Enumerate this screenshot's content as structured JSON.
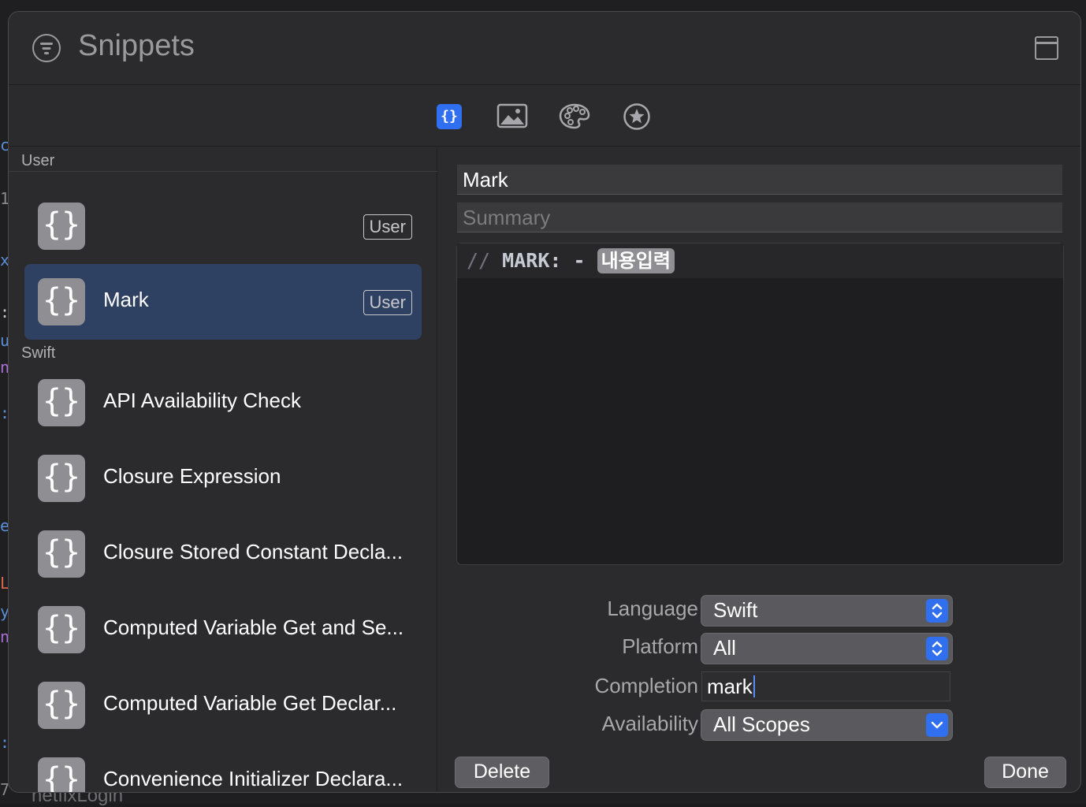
{
  "background": {
    "bottom_text": "netfixLogin"
  },
  "window": {
    "title": "Snippets",
    "filter_icon": "filter-icon",
    "layout_icon": "layout-icon"
  },
  "tabs": [
    {
      "name": "code-snippets",
      "label": "{}",
      "icon": "braces-icon",
      "selected": true
    },
    {
      "name": "media",
      "icon": "image-icon"
    },
    {
      "name": "colors",
      "icon": "palette-icon"
    },
    {
      "name": "symbols",
      "icon": "star-icon"
    }
  ],
  "sidebar": {
    "groups": {
      "user": "User",
      "swift": "Swift"
    },
    "icon_glyph": "{}",
    "user_items": [
      {
        "label": "",
        "badge": "User"
      },
      {
        "label": "Mark",
        "badge": "User",
        "selected": true
      }
    ],
    "swift_items": [
      {
        "label": "API Availability Check"
      },
      {
        "label": "Closure Expression"
      },
      {
        "label": "Closure Stored Constant Decla..."
      },
      {
        "label": "Computed Variable Get and Se..."
      },
      {
        "label": "Computed Variable Get Declar..."
      },
      {
        "label": "Convenience Initializer Declara..."
      }
    ]
  },
  "detail": {
    "name_value": "Mark",
    "summary_placeholder": "Summary",
    "code": {
      "comment": "//",
      "mark": "MARK: -",
      "placeholder_token": "내용입력"
    },
    "language_label": "Language",
    "language_value": "Swift",
    "platform_label": "Platform",
    "platform_value": "All",
    "completion_label": "Completion",
    "completion_value": "mark",
    "availability_label": "Availability",
    "availability_value": "All Scopes",
    "delete_label": "Delete",
    "done_label": "Done"
  },
  "colors": {
    "accent": "#2f6ff0",
    "selection": "#2f4163",
    "window_bg": "#2b2b2d"
  }
}
